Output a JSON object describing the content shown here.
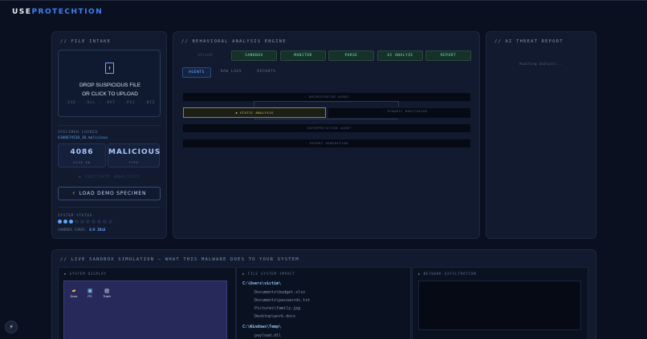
{
  "brand": {
    "part1": "USE",
    "part2": "PROTECHTION"
  },
  "intake": {
    "title": "// FILE INTAKE",
    "drop_line1": "DROP SUSPICIOUS FILE",
    "drop_line2": "OR CLICK TO UPLOAD",
    "extensions": ".EXE · .DLL · .BAT · .PS1 · .BIZ",
    "specimen_label": "SPECIMEN LOADED",
    "specimen_file": "6108674530_J0.malicious",
    "size_value": "4086",
    "size_label": "SIZE KB",
    "type_value": "MALICIOUS",
    "type_label": "TYPE",
    "analysis_text": "◆ INITIATE ANALYSIS",
    "demo_button": "LOAD DEMO SPECIMEN",
    "system_status_label": "SYSTEM STATUS",
    "cores_label": "SANDBOX CORES:",
    "cores_value": "3/8 IDLE",
    "status_dots_total": 10,
    "status_dots_active": 3
  },
  "engine": {
    "title": "// BEHAVIORAL ANALYSIS ENGINE",
    "stages": [
      "UPLOAD",
      "SANDBOX",
      "MONITOR",
      "PARSE",
      "AI ANALYZE",
      "REPORT"
    ],
    "subtabs": [
      "AGENTS",
      "RAW LOGS",
      "REPORTS"
    ],
    "agents": {
      "orchestrator": "◦ ORCHESTRATOR AGENT",
      "static": "◆ STATIC ANALYSIS",
      "dynamic": "◦ DYNAMIC MONITORING",
      "intel": "◦ INTERPRETATION AGENT",
      "report": "◦ REPORT GENERATION"
    }
  },
  "report": {
    "title": "// AI THREAT REPORT",
    "awaiting": "Awaiting analysis..."
  },
  "sandbox": {
    "title": "// LIVE SANDBOX SIMULATION — WHAT THIS MALWARE DOES TO YOUR SYSTEM",
    "display_title": "▶ SYSTEM DISPLAY",
    "fs_title": "▶ FILE SYSTEM IMPACT",
    "net_title": "▶ NETWORK EXFILTRATION",
    "desktop_icons": [
      {
        "label": "Docs",
        "icon": "folder-icon"
      },
      {
        "label": "PC",
        "icon": "computer-icon"
      },
      {
        "label": "Trash",
        "icon": "trash-icon"
      }
    ],
    "fs": {
      "dir1": "C:\\Users\\victim\\",
      "file1": "Documents\\budget.xlsx",
      "file2": "Documents\\passwords.txt",
      "file3": "Pictures\\family.jpg",
      "file4": "Desktop\\work.docx",
      "dir2": "C:\\Windows\\Temp\\",
      "file5": "payload.dll"
    }
  },
  "fab_icon": "bolt-icon",
  "colors": {
    "background": "#0b1020",
    "accent": "#3b82f6",
    "stage_active": "#6ee7b7",
    "highlight_agent": "#d5c86a"
  }
}
